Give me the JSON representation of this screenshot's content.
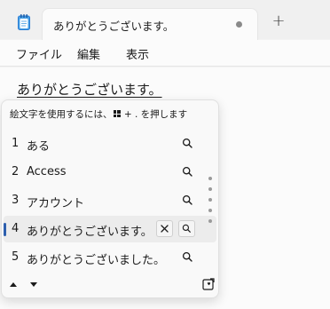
{
  "tab": {
    "title": "ありがとうございます。",
    "new_tab_label": "+"
  },
  "menu": {
    "items": [
      "ファイル",
      "編集",
      "表示"
    ]
  },
  "editor": {
    "text": "ありがとうございます。"
  },
  "ime": {
    "hint_prefix": "絵文字を使用するには、",
    "hint_suffix": "+ . を押します",
    "candidates": [
      {
        "num": "1",
        "text": "ある"
      },
      {
        "num": "2",
        "text": "Access"
      },
      {
        "num": "3",
        "text": "アカウント"
      },
      {
        "num": "4",
        "text": "ありがとうございます。",
        "selected": true
      },
      {
        "num": "5",
        "text": "ありがとうございました。"
      }
    ]
  },
  "colors": {
    "selection_accent": "#2d5fae",
    "notepad_icon": "#2b7cd3"
  }
}
